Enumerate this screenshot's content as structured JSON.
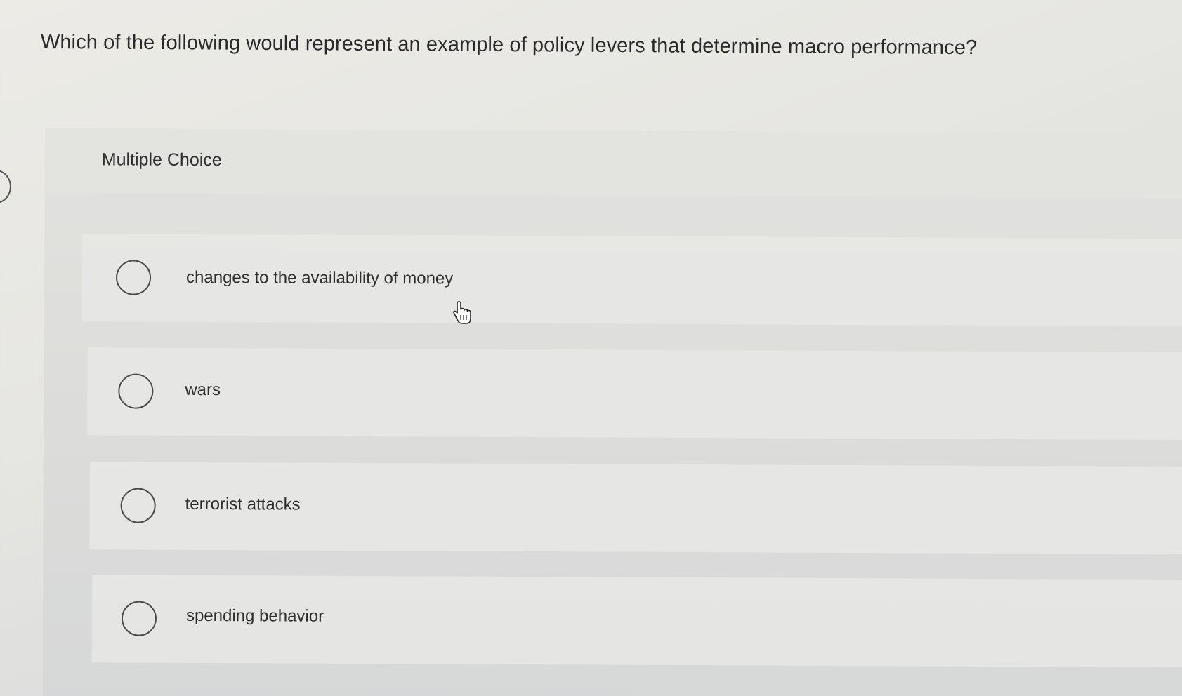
{
  "question": {
    "text": "Which of the following would represent an example of policy levers that determine macro performance?"
  },
  "section": {
    "label": "Multiple Choice"
  },
  "options": [
    {
      "label": "changes to the availability of money"
    },
    {
      "label": "wars"
    },
    {
      "label": "terrorist attacks"
    },
    {
      "label": "spending behavior"
    }
  ],
  "colors": {
    "background": "#e6e6e2",
    "panel": "#dcdcda",
    "text": "#2b2b2b",
    "radio_border": "#4a4a4a"
  },
  "icons": {
    "cursor": "hand-pointer-icon",
    "radio": "radio-button-icon"
  }
}
